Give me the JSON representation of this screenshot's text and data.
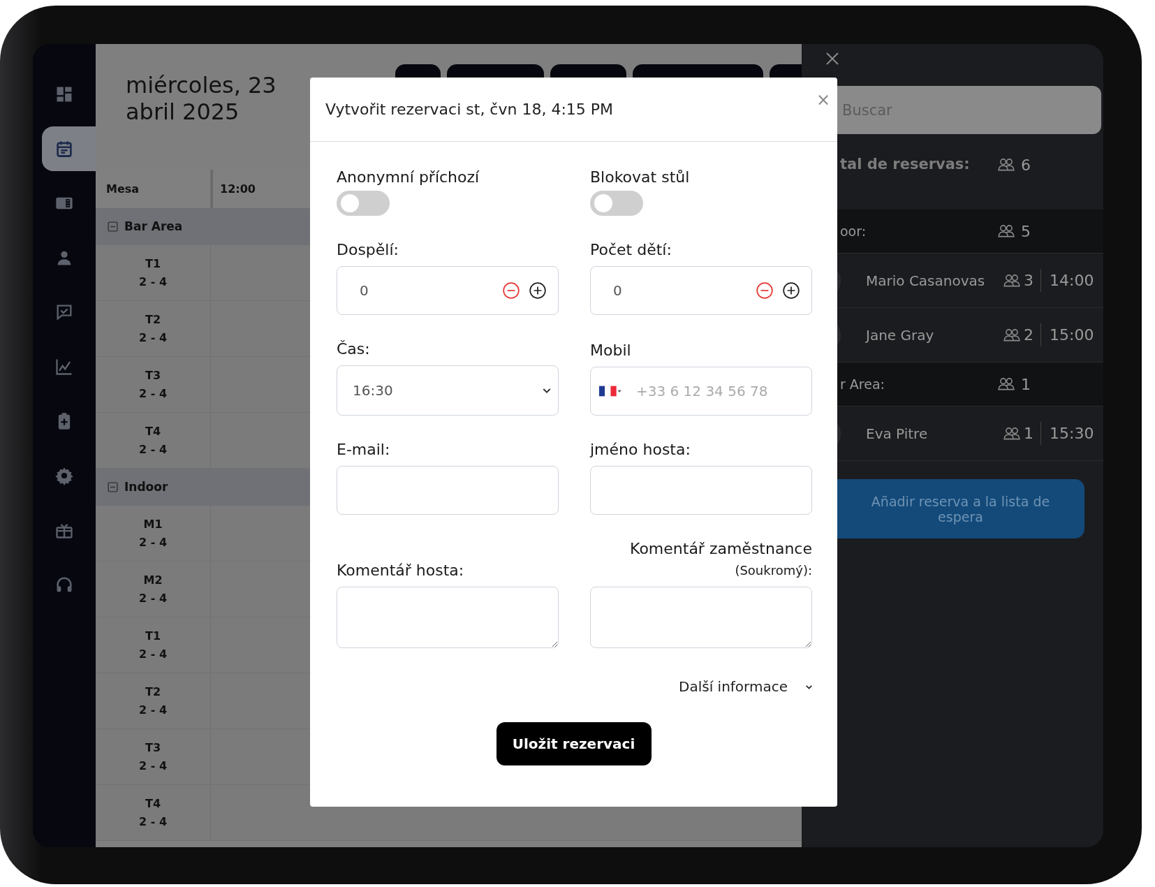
{
  "sidebar": {
    "items": [
      {
        "selected": false
      },
      {
        "selected": true
      },
      {
        "selected": false
      },
      {
        "selected": false
      },
      {
        "selected": false
      },
      {
        "selected": false
      },
      {
        "selected": false
      },
      {
        "selected": false
      },
      {
        "selected": false
      },
      {
        "selected": false
      }
    ]
  },
  "schedule": {
    "date": "miércoles, 23 abril 2025",
    "columns": [
      "Mesa",
      "12:00"
    ],
    "groups": [
      {
        "name": "Bar Area",
        "expanded": true,
        "tables": [
          {
            "name": "T1",
            "capacity": "2 - 4"
          },
          {
            "name": "T2",
            "capacity": "2 - 4"
          },
          {
            "name": "T3",
            "capacity": "2 - 4"
          },
          {
            "name": "T4",
            "capacity": "2 - 4"
          }
        ]
      },
      {
        "name": "Indoor",
        "expanded": true,
        "tables": [
          {
            "name": "M1",
            "capacity": "2 - 4"
          },
          {
            "name": "M2",
            "capacity": "2 - 4"
          },
          {
            "name": "T1",
            "capacity": "2 - 4"
          },
          {
            "name": "T2",
            "capacity": "2 - 4"
          },
          {
            "name": "T3",
            "capacity": "2 - 4"
          },
          {
            "name": "T4",
            "capacity": "2 - 4"
          }
        ]
      }
    ]
  },
  "reservation_dialog": {
    "title": "Vytvořit rezervaci st, čvn 18, 4:15 PM",
    "close": "×",
    "fields": [
      {
        "kind": "toggle",
        "label": "Anonymní příchozí",
        "on": false
      },
      {
        "kind": "toggle",
        "label": "Blokovat stůl",
        "on": false
      },
      {
        "kind": "counter",
        "label": "Dospělí:",
        "value": "0"
      },
      {
        "kind": "counter",
        "label": "Počet dětí:",
        "value": "0"
      },
      {
        "kind": "select",
        "label": "Čas:",
        "value": "16:30"
      },
      {
        "kind": "phone",
        "label": "Mobil",
        "placeholder": "+33 6 12 34 56 78"
      },
      {
        "kind": "text",
        "label": "E-mail:"
      },
      {
        "kind": "text",
        "label": "jméno hosta:"
      },
      {
        "kind": "textarea",
        "label": "Komentář hosta:"
      },
      {
        "kind": "textarea",
        "label": "Komentář zaměstnance",
        "note": "(Soukromý):"
      }
    ],
    "more_info": "Další informace",
    "save_button": "Uložit rezervaci"
  },
  "side_panel": {
    "search": {
      "placeholder": "Buscar"
    },
    "total_label": "tal de reservas:",
    "total": "6",
    "sections": [
      {
        "name": "oor:",
        "count": "5",
        "reservations": [
          {
            "name": "Mario Casanovas",
            "guests": "3",
            "time": "14:00"
          },
          {
            "name": "Jane Gray",
            "guests": "2",
            "time": "15:00"
          }
        ]
      },
      {
        "name": "r Area:",
        "count": "1",
        "reservations": [
          {
            "name": "Eva Pitre",
            "guests": "1",
            "time": "15:30"
          }
        ]
      }
    ],
    "waitlist_button": "Añadir reserva a la lista de espera"
  }
}
